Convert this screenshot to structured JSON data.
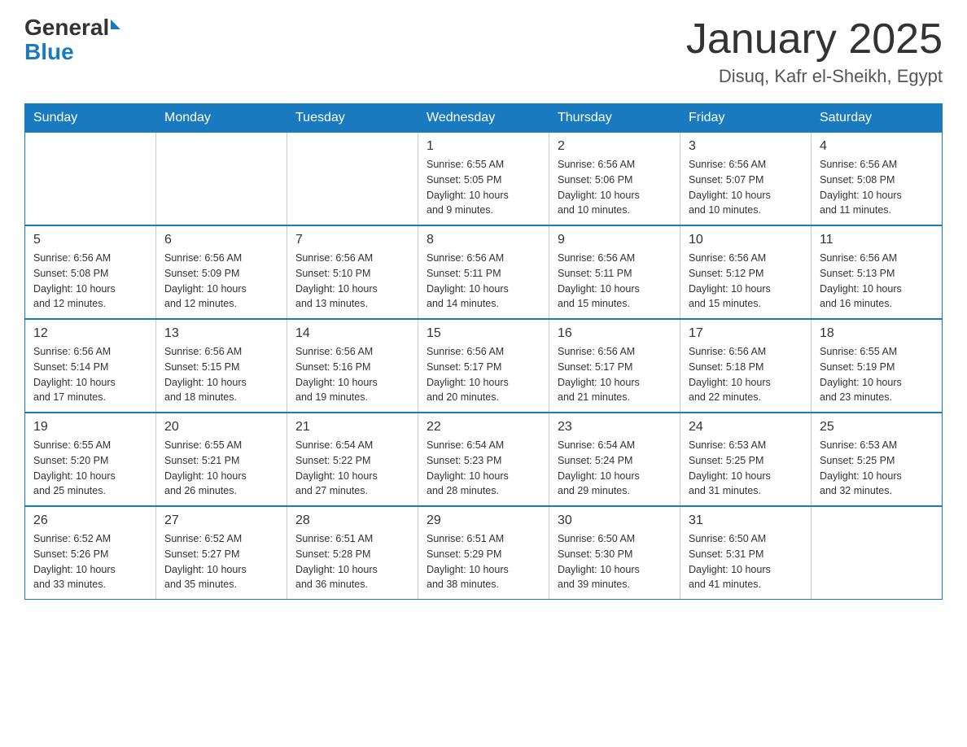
{
  "header": {
    "logo_general": "General",
    "logo_blue": "Blue",
    "month_title": "January 2025",
    "location": "Disuq, Kafr el-Sheikh, Egypt"
  },
  "calendar": {
    "days_of_week": [
      "Sunday",
      "Monday",
      "Tuesday",
      "Wednesday",
      "Thursday",
      "Friday",
      "Saturday"
    ],
    "weeks": [
      [
        {
          "day": "",
          "info": ""
        },
        {
          "day": "",
          "info": ""
        },
        {
          "day": "",
          "info": ""
        },
        {
          "day": "1",
          "info": "Sunrise: 6:55 AM\nSunset: 5:05 PM\nDaylight: 10 hours\nand 9 minutes."
        },
        {
          "day": "2",
          "info": "Sunrise: 6:56 AM\nSunset: 5:06 PM\nDaylight: 10 hours\nand 10 minutes."
        },
        {
          "day": "3",
          "info": "Sunrise: 6:56 AM\nSunset: 5:07 PM\nDaylight: 10 hours\nand 10 minutes."
        },
        {
          "day": "4",
          "info": "Sunrise: 6:56 AM\nSunset: 5:08 PM\nDaylight: 10 hours\nand 11 minutes."
        }
      ],
      [
        {
          "day": "5",
          "info": "Sunrise: 6:56 AM\nSunset: 5:08 PM\nDaylight: 10 hours\nand 12 minutes."
        },
        {
          "day": "6",
          "info": "Sunrise: 6:56 AM\nSunset: 5:09 PM\nDaylight: 10 hours\nand 12 minutes."
        },
        {
          "day": "7",
          "info": "Sunrise: 6:56 AM\nSunset: 5:10 PM\nDaylight: 10 hours\nand 13 minutes."
        },
        {
          "day": "8",
          "info": "Sunrise: 6:56 AM\nSunset: 5:11 PM\nDaylight: 10 hours\nand 14 minutes."
        },
        {
          "day": "9",
          "info": "Sunrise: 6:56 AM\nSunset: 5:11 PM\nDaylight: 10 hours\nand 15 minutes."
        },
        {
          "day": "10",
          "info": "Sunrise: 6:56 AM\nSunset: 5:12 PM\nDaylight: 10 hours\nand 15 minutes."
        },
        {
          "day": "11",
          "info": "Sunrise: 6:56 AM\nSunset: 5:13 PM\nDaylight: 10 hours\nand 16 minutes."
        }
      ],
      [
        {
          "day": "12",
          "info": "Sunrise: 6:56 AM\nSunset: 5:14 PM\nDaylight: 10 hours\nand 17 minutes."
        },
        {
          "day": "13",
          "info": "Sunrise: 6:56 AM\nSunset: 5:15 PM\nDaylight: 10 hours\nand 18 minutes."
        },
        {
          "day": "14",
          "info": "Sunrise: 6:56 AM\nSunset: 5:16 PM\nDaylight: 10 hours\nand 19 minutes."
        },
        {
          "day": "15",
          "info": "Sunrise: 6:56 AM\nSunset: 5:17 PM\nDaylight: 10 hours\nand 20 minutes."
        },
        {
          "day": "16",
          "info": "Sunrise: 6:56 AM\nSunset: 5:17 PM\nDaylight: 10 hours\nand 21 minutes."
        },
        {
          "day": "17",
          "info": "Sunrise: 6:56 AM\nSunset: 5:18 PM\nDaylight: 10 hours\nand 22 minutes."
        },
        {
          "day": "18",
          "info": "Sunrise: 6:55 AM\nSunset: 5:19 PM\nDaylight: 10 hours\nand 23 minutes."
        }
      ],
      [
        {
          "day": "19",
          "info": "Sunrise: 6:55 AM\nSunset: 5:20 PM\nDaylight: 10 hours\nand 25 minutes."
        },
        {
          "day": "20",
          "info": "Sunrise: 6:55 AM\nSunset: 5:21 PM\nDaylight: 10 hours\nand 26 minutes."
        },
        {
          "day": "21",
          "info": "Sunrise: 6:54 AM\nSunset: 5:22 PM\nDaylight: 10 hours\nand 27 minutes."
        },
        {
          "day": "22",
          "info": "Sunrise: 6:54 AM\nSunset: 5:23 PM\nDaylight: 10 hours\nand 28 minutes."
        },
        {
          "day": "23",
          "info": "Sunrise: 6:54 AM\nSunset: 5:24 PM\nDaylight: 10 hours\nand 29 minutes."
        },
        {
          "day": "24",
          "info": "Sunrise: 6:53 AM\nSunset: 5:25 PM\nDaylight: 10 hours\nand 31 minutes."
        },
        {
          "day": "25",
          "info": "Sunrise: 6:53 AM\nSunset: 5:25 PM\nDaylight: 10 hours\nand 32 minutes."
        }
      ],
      [
        {
          "day": "26",
          "info": "Sunrise: 6:52 AM\nSunset: 5:26 PM\nDaylight: 10 hours\nand 33 minutes."
        },
        {
          "day": "27",
          "info": "Sunrise: 6:52 AM\nSunset: 5:27 PM\nDaylight: 10 hours\nand 35 minutes."
        },
        {
          "day": "28",
          "info": "Sunrise: 6:51 AM\nSunset: 5:28 PM\nDaylight: 10 hours\nand 36 minutes."
        },
        {
          "day": "29",
          "info": "Sunrise: 6:51 AM\nSunset: 5:29 PM\nDaylight: 10 hours\nand 38 minutes."
        },
        {
          "day": "30",
          "info": "Sunrise: 6:50 AM\nSunset: 5:30 PM\nDaylight: 10 hours\nand 39 minutes."
        },
        {
          "day": "31",
          "info": "Sunrise: 6:50 AM\nSunset: 5:31 PM\nDaylight: 10 hours\nand 41 minutes."
        },
        {
          "day": "",
          "info": ""
        }
      ]
    ]
  }
}
